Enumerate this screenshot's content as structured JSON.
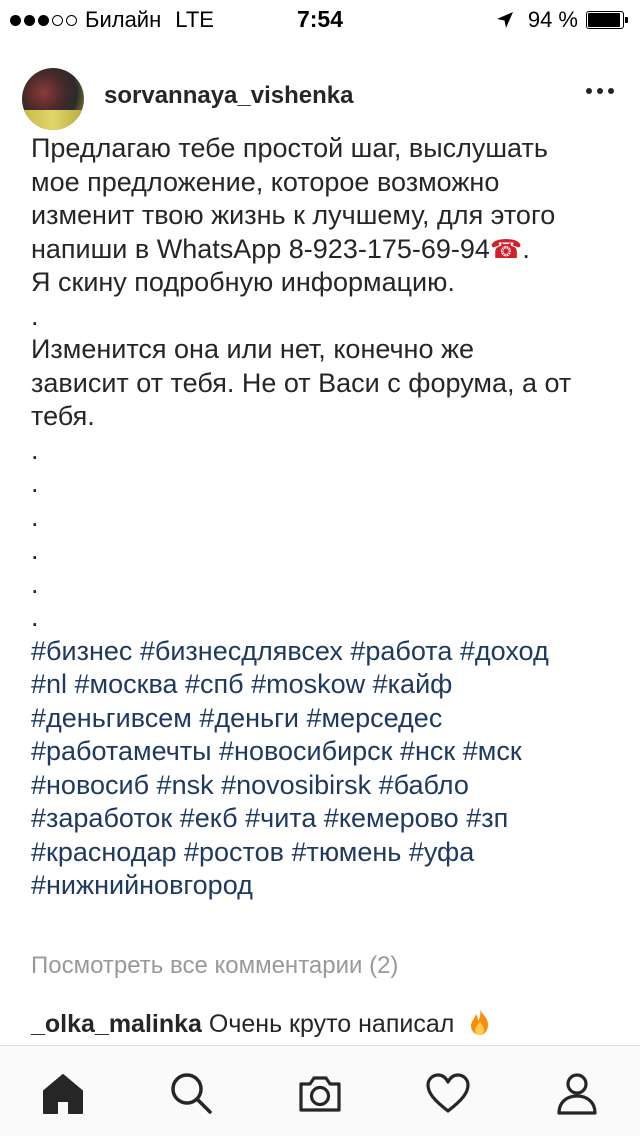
{
  "status_bar": {
    "carrier": "Билайн",
    "network": "LTE",
    "time": "7:54",
    "battery": "94 %",
    "battery_level": 0.94,
    "signal_bars_filled": 3,
    "signal_bars_total": 5
  },
  "post": {
    "username": "sorvannaya_vishenka",
    "caption_lines": [
      "Предлагаю тебе простой шаг, выслушать",
      "мое предложение, которое возможно",
      "изменит твою жизнь к лучшему, для этого",
      "напиши в WhatsApp 8-923-175-69-94",
      "Я скину подробную информацию.",
      ".",
      "Изменится она или нет, конечно же",
      "зависит от тебя. Не от Васи с форума, а от",
      "тебя.",
      ".",
      ".",
      ".",
      ".",
      ".",
      "."
    ],
    "phone_emoji": "☎",
    "phone_suffix": ".",
    "hashtag_lines": [
      "#бизнес #бизнесдлявсех #работа #доход",
      "#nl #москва #спб #moskow #кайф",
      "#деньгивсем #деньги #мерседес",
      "#работамечты #новосибирск #нск #мск",
      "#новосиб #nsk #novosibirsk #бабло",
      "#заработок #екб #чита #кемерово #зп",
      "#краснодар #ростов #тюмень #уфа",
      "#нижнийновгород"
    ],
    "view_comments": "Посмотреть все комментарии (2)",
    "comment": {
      "user": "_olka_malinka",
      "text": "Очень круто написал"
    }
  },
  "colors": {
    "hashtag": "#1f3a60",
    "muted": "#999999",
    "text": "#262626"
  },
  "icons": {
    "tabs": [
      "home-icon",
      "search-icon",
      "camera-icon",
      "heart-icon",
      "profile-icon"
    ],
    "comment_emoji": "fire-icon"
  }
}
